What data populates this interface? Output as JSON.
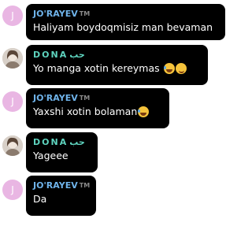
{
  "messages": [
    {
      "sender": "JO'RAYEV",
      "tag": "TM",
      "avatar_letter": "J",
      "text": "Haliyam boydoqmisiz man bevaman"
    },
    {
      "sender": "DONA",
      "sender_suffix": "حب",
      "avatar_type": "photo",
      "text": "Yo manga xotin kereymas",
      "emojis": [
        "grinning-sweat-emoji",
        "wink-emoji"
      ]
    },
    {
      "sender": "JO'RAYEV",
      "tag": "TM",
      "avatar_letter": "J",
      "text": "Yaxshi xotin bolaman",
      "emojis": [
        "grinning-sweat-emoji"
      ]
    },
    {
      "sender": "DONA",
      "sender_suffix": "حب",
      "avatar_type": "photo",
      "text": "Yageee"
    },
    {
      "sender": "JO'RAYEV",
      "tag": "TM",
      "avatar_letter": "J",
      "text": "Da"
    }
  ],
  "colors": {
    "bubble_background": "#000000",
    "joraev_name": "#6fb3ea",
    "dona_name": "#5ed3be",
    "avatar_letter_background": "#e9b6e3",
    "tag": "#8a8a8a"
  }
}
